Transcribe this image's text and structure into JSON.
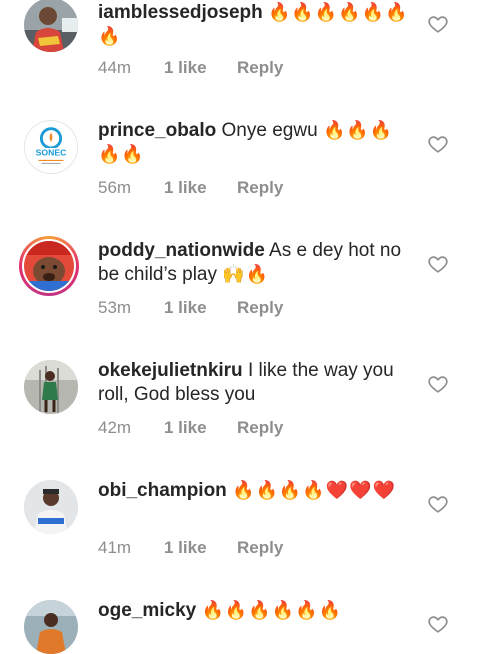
{
  "comments": [
    {
      "username": "iamblessedjoseph",
      "text": "",
      "emojis": "🔥🔥🔥🔥🔥🔥🔥",
      "time": "44m",
      "likes": "1 like",
      "reply": "Reply"
    },
    {
      "username": "prince_obalo",
      "text": "Onye egwu",
      "emojis": "🔥🔥🔥🔥🔥",
      "time": "56m",
      "likes": "1 like",
      "reply": "Reply"
    },
    {
      "username": "poddy_nationwide",
      "text": "As e dey hot no be child’s play",
      "emojis": "🙌🔥",
      "time": "53m",
      "likes": "1 like",
      "reply": "Reply"
    },
    {
      "username": "okekejulietnkiru",
      "text": "I like the way you roll, God bless you",
      "emojis": "",
      "time": "42m",
      "likes": "1 like",
      "reply": "Reply"
    },
    {
      "username": "obi_champion",
      "text": "",
      "emojis": "🔥🔥🔥🔥❤️❤️❤️",
      "time": "41m",
      "likes": "1 like",
      "reply": "Reply"
    },
    {
      "username": "oge_micky",
      "text": "",
      "emojis": "🔥🔥🔥🔥🔥🔥",
      "time": "",
      "likes": "",
      "reply": ""
    }
  ],
  "avatar_labels": {
    "sonec": "SONEC"
  },
  "colors": {
    "username": "#262626",
    "meta": "#8e8e8e",
    "story_ring": "#e1306c",
    "fire": "#f07a12",
    "heart": "#d81b2a"
  },
  "icons": {
    "like": "heart-outline-icon"
  }
}
